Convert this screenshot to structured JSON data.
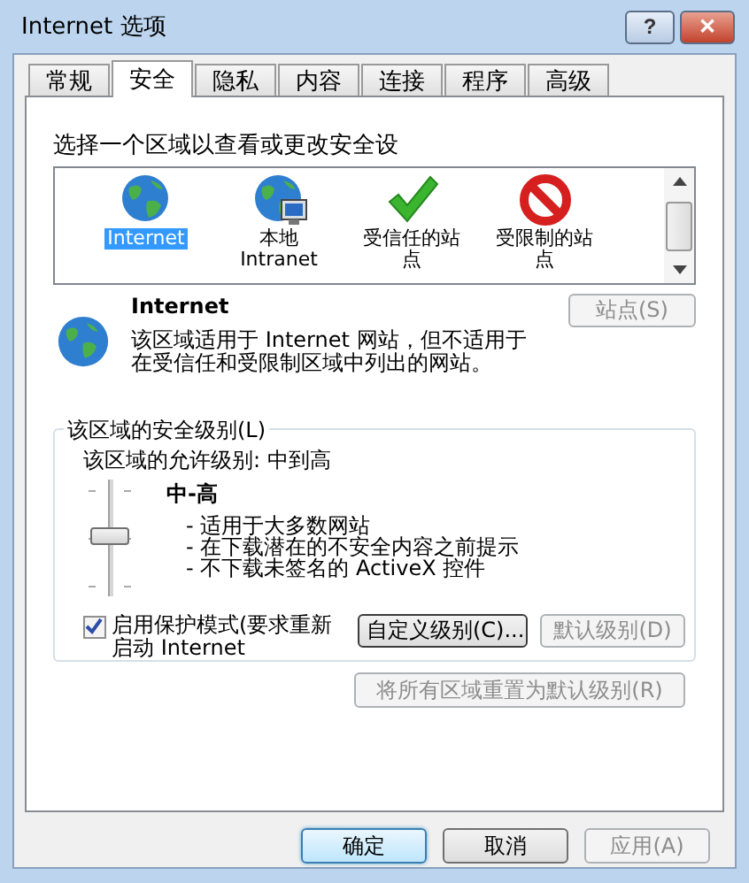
{
  "window": {
    "title": "Internet 选项",
    "help_button": "?",
    "close_button": "✕"
  },
  "tabs": [
    {
      "label": "常规",
      "selected": false
    },
    {
      "label": "安全",
      "selected": true
    },
    {
      "label": "隐私",
      "selected": false
    },
    {
      "label": "内容",
      "selected": false
    },
    {
      "label": "连接",
      "selected": false
    },
    {
      "label": "程序",
      "selected": false
    },
    {
      "label": "高级",
      "selected": false
    }
  ],
  "zone_prompt": "选择一个区域以查看或更改安全设",
  "zones": [
    {
      "kind": "globe",
      "label": "Internet",
      "selected": true
    },
    {
      "kind": "network",
      "label": "本地 Intranet",
      "selected": false
    },
    {
      "kind": "check",
      "label": "受信任的站点",
      "selected": false
    },
    {
      "kind": "blocked",
      "label": "受限制的站点",
      "selected": false
    }
  ],
  "zone_info": {
    "name": "Internet",
    "description": "该区域适用于 Internet 网站，但不适用于在受信任和受限制区域中列出的网站。",
    "sites_button": {
      "label": "站点(S)",
      "disabled": true
    }
  },
  "security_level": {
    "legend": "该区域的安全级别(L)",
    "allowed": "该区域的允许级别: 中到高",
    "level": 0.5,
    "level_name": "中-高",
    "bullets": [
      "- 适用于大多数网站",
      "- 在下载潜在的不安全内容之前提示",
      "- 不下载未签名的 ActiveX 控件"
    ],
    "protected_mode": {
      "label": "启用保护模式(要求重新启动 Internet",
      "checked": true
    },
    "custom_button": {
      "label": "自定义级别(C)...",
      "disabled": false
    },
    "default_button": {
      "label": "默认级别(D)",
      "disabled": true
    }
  },
  "reset_button": {
    "label": "将所有区域重置为默认级别(R)",
    "disabled": true
  },
  "buttons": [
    {
      "label": "确定",
      "disabled": false,
      "default": true
    },
    {
      "label": "取消",
      "disabled": false,
      "default": false
    },
    {
      "label": "应用(A)",
      "disabled": true,
      "default": false
    }
  ]
}
